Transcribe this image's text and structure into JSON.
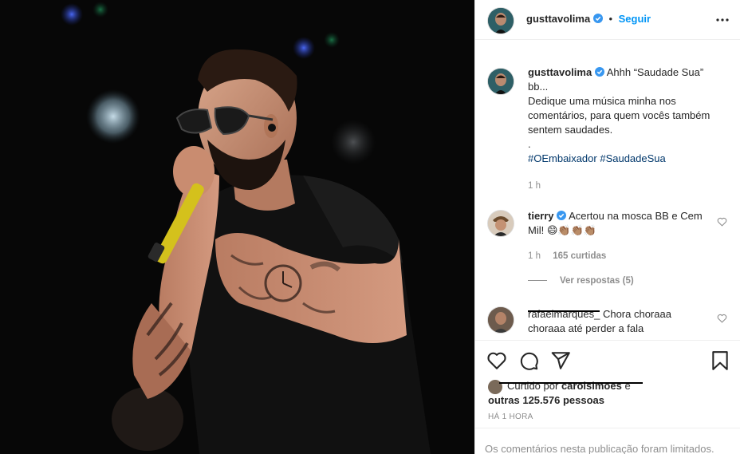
{
  "post": {
    "author": "gusttavolima",
    "follow_label": "Seguir",
    "separator": "•",
    "caption_lines": [
      "Ahhh “Saudade Sua” bb...",
      "Dedique uma música minha nos comentários, para quem vocês também sentem saudades.",
      "."
    ],
    "hashtags": [
      "#OEmbaixador",
      "#SaudadeSua"
    ],
    "caption_time": "1 h"
  },
  "comments": [
    {
      "user": "tierry",
      "text": "Acertou na mosca BB e Cem Mil!",
      "emojis": "😄👏🏽👏🏽👏🏽",
      "time": "1 h",
      "likes": "165 curtidas",
      "replies_label": "Ver respostas (5)"
    },
    {
      "user": "rafaelmarques_",
      "text": "Chora choraaa choraaa até perder a fala"
    }
  ],
  "likes_block": {
    "line1_prefix": "Curtido por",
    "line1_user": "carolsimoes",
    "line1_suffix": "e",
    "line2": "outras 125.576 pessoas"
  },
  "timestamp_label": "HÁ 1 HORA",
  "comments_limited": "Os comentários nesta publicação foram limitados.",
  "colors": {
    "accent": "#0095f6",
    "hashtag": "#00376b",
    "muted": "#8e8e8e",
    "verified": "#3897f0"
  },
  "icons": [
    "verified-badge-icon",
    "more-options-icon",
    "heart-icon",
    "comment-icon",
    "share-icon",
    "bookmark-icon"
  ]
}
